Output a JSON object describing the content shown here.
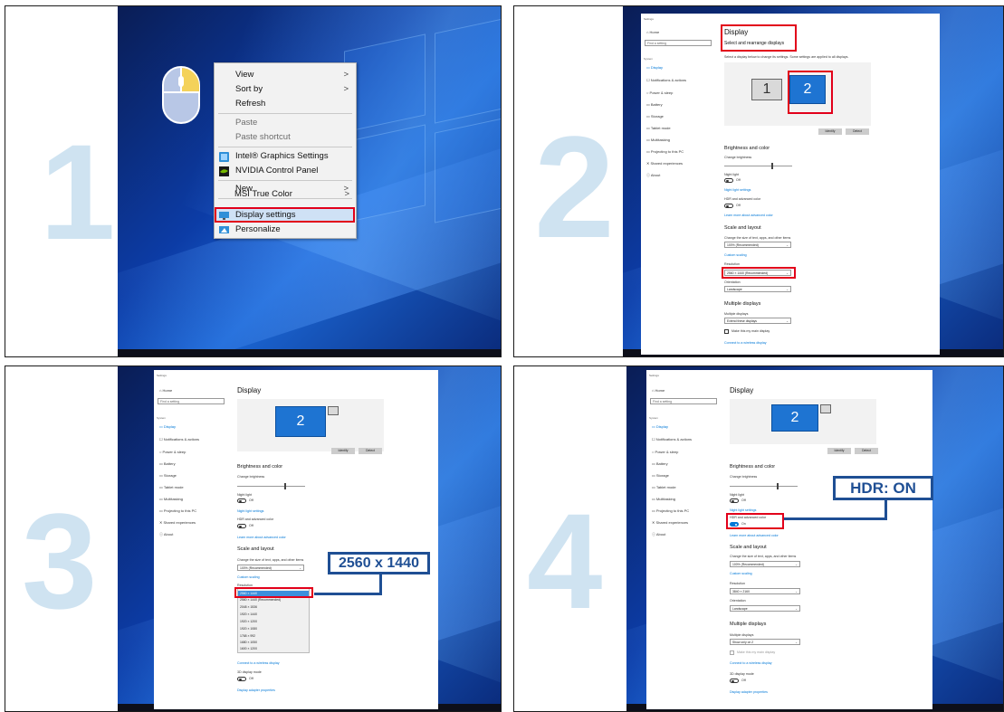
{
  "steps": [
    "1",
    "2",
    "3",
    "4"
  ],
  "panel1": {
    "context_menu": {
      "items": [
        {
          "label": "View",
          "submenu": true
        },
        {
          "label": "Sort by",
          "submenu": true
        },
        {
          "label": "Refresh",
          "submenu": false
        },
        {
          "label": "Paste",
          "submenu": false
        },
        {
          "label": "Paste shortcut",
          "submenu": false
        },
        {
          "label": "Intel® Graphics Settings",
          "submenu": false
        },
        {
          "label": "NVIDIA Control Panel",
          "submenu": false
        },
        {
          "label": "New",
          "submenu": true
        },
        {
          "label": "MSI True Color",
          "submenu": true
        },
        {
          "label": "Display settings",
          "submenu": false
        },
        {
          "label": "Personalize",
          "submenu": false
        }
      ],
      "submenu_arrow": ">"
    }
  },
  "settings": {
    "window_title": "Settings",
    "home": "Home",
    "search_placeholder": "Find a setting",
    "section": "System",
    "nav": [
      "Display",
      "Notifications & actions",
      "Power & sleep",
      "Battery",
      "Storage",
      "Tablet mode",
      "Multitasking",
      "Projecting to this PC",
      "Shared experiences",
      "About"
    ],
    "title": "Display",
    "select_rearrange": "Select and rearrange displays",
    "select_desc": "Select a display below to change its settings. Some settings are applied to all displays.",
    "monitor1": "1",
    "monitor2": "2",
    "identify": "Identify",
    "detect": "Detect",
    "brightness_heading": "Brightness and color",
    "change_brightness": "Change brightness",
    "night_light": "Night light",
    "off": "Off",
    "on": "On",
    "night_light_settings": "Night light settings",
    "hdr_label": "HDR and advanced color",
    "hdr_link": "Learn more about advanced color",
    "scale_heading": "Scale and layout",
    "scale_desc": "Change the size of text, apps, and other items",
    "scale_value": "100% (Recommended)",
    "custom_scaling": "Custom scaling",
    "resolution_label": "Resolution",
    "resolution_p2": "2560 × 1440 (Recommended)",
    "resolution_p4": "3840 × 2160",
    "orientation_label": "Orientation",
    "orientation_value": "Landscape",
    "multiple_heading": "Multiple displays",
    "multiple_label": "Multiple displays",
    "multiple_value_p2": "Extend these displays",
    "multiple_value_p4": "Show only on 2",
    "main_display": "Make this my main display",
    "wireless": "Connect to a wireless display",
    "display_mode": "3D display mode",
    "adapter_props": "Display adapter properties",
    "resolution_options": [
      "2560 × 1440",
      "2560 × 1440 (Recommended)",
      "2048 × 1536",
      "1920 × 1440",
      "1920 × 1200",
      "1920 × 1080",
      "1768 × 992",
      "1680 × 1050",
      "1600 × 1200"
    ]
  },
  "callouts": {
    "resolution": "2560 x 1440",
    "hdr": "HDR: ON"
  },
  "colors": {
    "highlight_red": "#e2001a",
    "callout_blue": "#1f4f94",
    "step_number": "#cfe3f1",
    "accent": "#0078d7"
  }
}
